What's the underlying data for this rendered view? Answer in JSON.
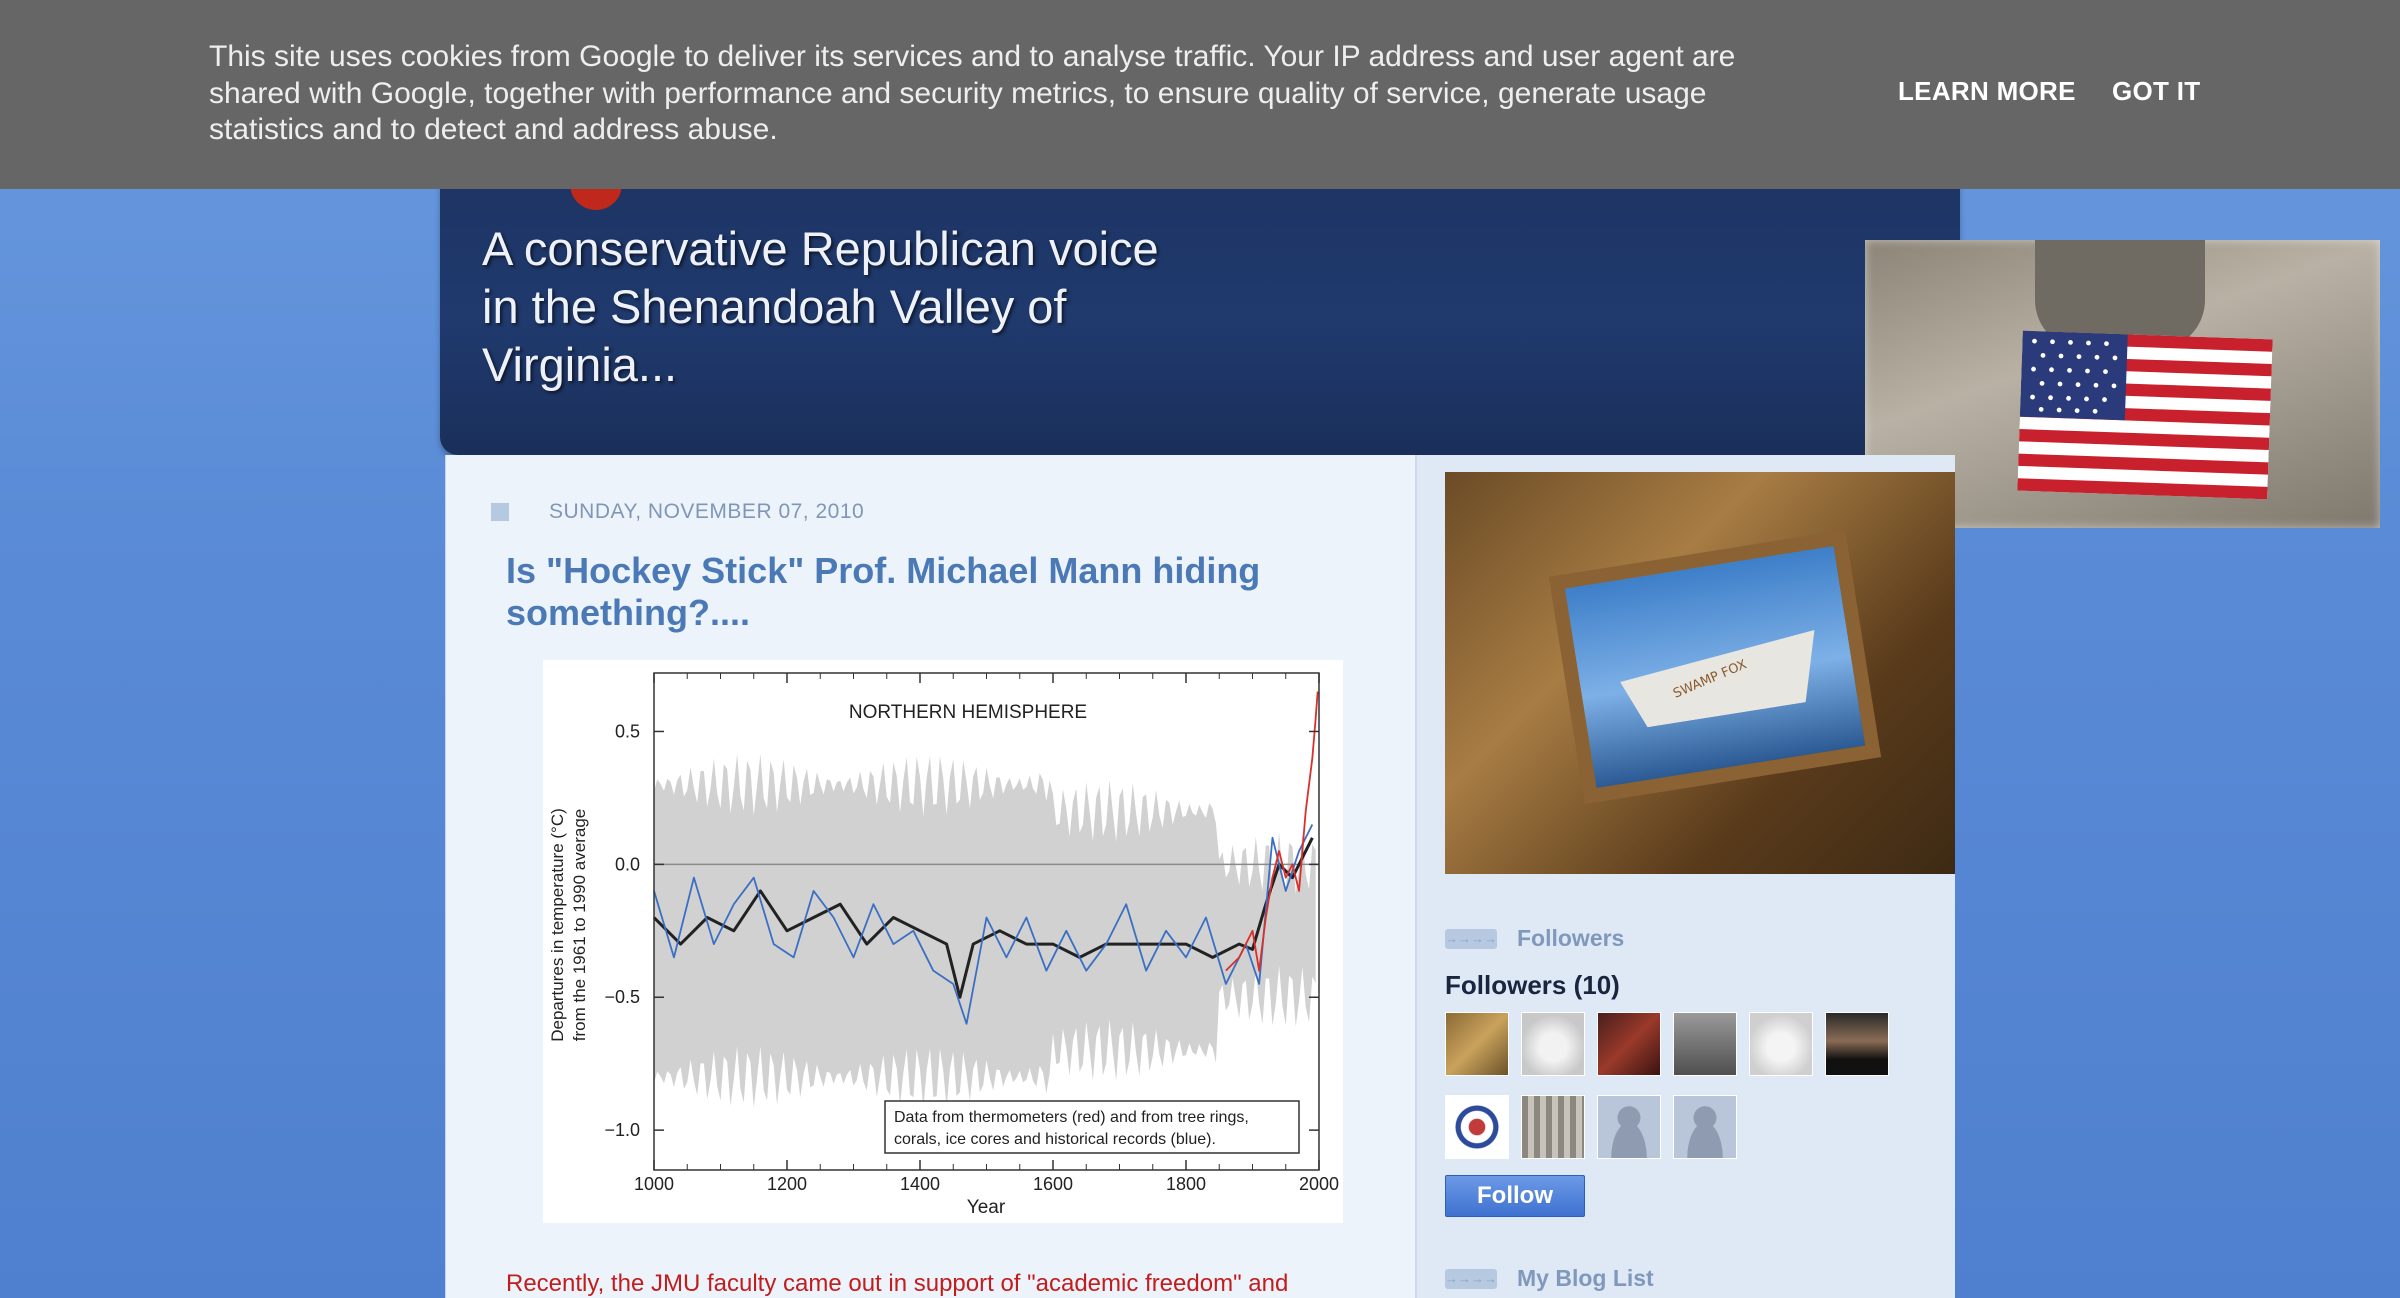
{
  "header": {
    "tagline": "A conservative Republican voice in the Shenandoah Valley of Virginia..."
  },
  "post": {
    "date": "SUNDAY, NOVEMBER 07, 2010",
    "title": "Is \"Hockey Stick\" Prof. Michael Mann hiding something?....",
    "body_start": "Recently, the JMU faculty came out in support of \"academic freedom\" and"
  },
  "chart_data": {
    "type": "line",
    "title": "NORTHERN HEMISPHERE",
    "xlabel": "Year",
    "ylabel_line1": "Departures in temperature (°C)",
    "ylabel_line2": "from the 1961 to 1990 average",
    "xlim": [
      1000,
      2000
    ],
    "ylim": [
      -1.15,
      0.72
    ],
    "x_ticks": [
      "1000",
      "1200",
      "1400",
      "1600",
      "1800",
      "2000"
    ],
    "y_ticks": [
      "0.5",
      "0.0",
      "−0.5",
      "−1.0"
    ],
    "y_tick_values": [
      0.5,
      0.0,
      -0.5,
      -1.0
    ],
    "annotation": "Data from thermometers (red) and from tree rings, corals, ice cores and historical records (blue).",
    "annotation_line1": "Data from thermometers (red) and from tree rings,",
    "annotation_line2": "corals, ice cores and historical records (blue).",
    "series": [
      {
        "color": "#222222",
        "x": [
          1000,
          1040,
          1080,
          1120,
          1160,
          1200,
          1240,
          1280,
          1320,
          1360,
          1400,
          1440,
          1460,
          1480,
          1520,
          1560,
          1600,
          1640,
          1680,
          1720,
          1760,
          1800,
          1840,
          1880,
          1900,
          1920,
          1940,
          1960,
          1980,
          1990
        ],
        "y": [
          -0.2,
          -0.3,
          -0.2,
          -0.25,
          -0.1,
          -0.25,
          -0.2,
          -0.15,
          -0.3,
          -0.2,
          -0.25,
          -0.3,
          -0.5,
          -0.3,
          -0.25,
          -0.3,
          -0.3,
          -0.35,
          -0.3,
          -0.3,
          -0.3,
          -0.3,
          -0.35,
          -0.3,
          -0.32,
          -0.15,
          0.0,
          -0.05,
          0.05,
          0.1
        ]
      },
      {
        "color": "#3a6fc4",
        "x": [
          1000,
          1030,
          1060,
          1090,
          1120,
          1150,
          1180,
          1210,
          1240,
          1270,
          1300,
          1330,
          1360,
          1390,
          1420,
          1450,
          1470,
          1500,
          1530,
          1560,
          1590,
          1620,
          1650,
          1680,
          1710,
          1740,
          1770,
          1800,
          1830,
          1860,
          1890,
          1910,
          1930,
          1950,
          1970,
          1990
        ],
        "y": [
          -0.1,
          -0.35,
          -0.05,
          -0.3,
          -0.15,
          -0.05,
          -0.3,
          -0.35,
          -0.1,
          -0.2,
          -0.35,
          -0.15,
          -0.3,
          -0.25,
          -0.4,
          -0.45,
          -0.6,
          -0.2,
          -0.35,
          -0.2,
          -0.4,
          -0.25,
          -0.4,
          -0.3,
          -0.15,
          -0.4,
          -0.25,
          -0.35,
          -0.2,
          -0.45,
          -0.3,
          -0.45,
          0.1,
          -0.1,
          0.05,
          0.15
        ]
      },
      {
        "color": "#d9302a",
        "x": [
          1860,
          1880,
          1900,
          1910,
          1920,
          1930,
          1940,
          1950,
          1960,
          1970,
          1980,
          1990,
          1995,
          1998
        ],
        "y": [
          -0.4,
          -0.35,
          -0.25,
          -0.4,
          -0.2,
          -0.05,
          0.05,
          -0.05,
          0.0,
          -0.1,
          0.2,
          0.4,
          0.55,
          0.65
        ]
      }
    ]
  },
  "sidebar": {
    "boat_name": "SWAMP FOX",
    "followers_widget_title": "Followers",
    "followers_count": "Followers (10)",
    "follow_button": "Follow",
    "blog_list_title": "My Blog List",
    "arrow_glyph": "→→→→"
  },
  "cookie": {
    "text": "This site uses cookies from Google to deliver its services and to analyse traffic. Your IP address and user agent are shared with Google, together with performance and security metrics, to ensure quality of service, generate usage statistics and to detect and address abuse.",
    "learn_more": "LEARN MORE",
    "got_it": "GOT IT"
  },
  "colors": {
    "page_bg": "#5a8bd6",
    "header_bg": "#1c3260",
    "title_blue": "#4a79b6",
    "body_red": "#c21d1d",
    "cookie_bg": "#666666"
  }
}
